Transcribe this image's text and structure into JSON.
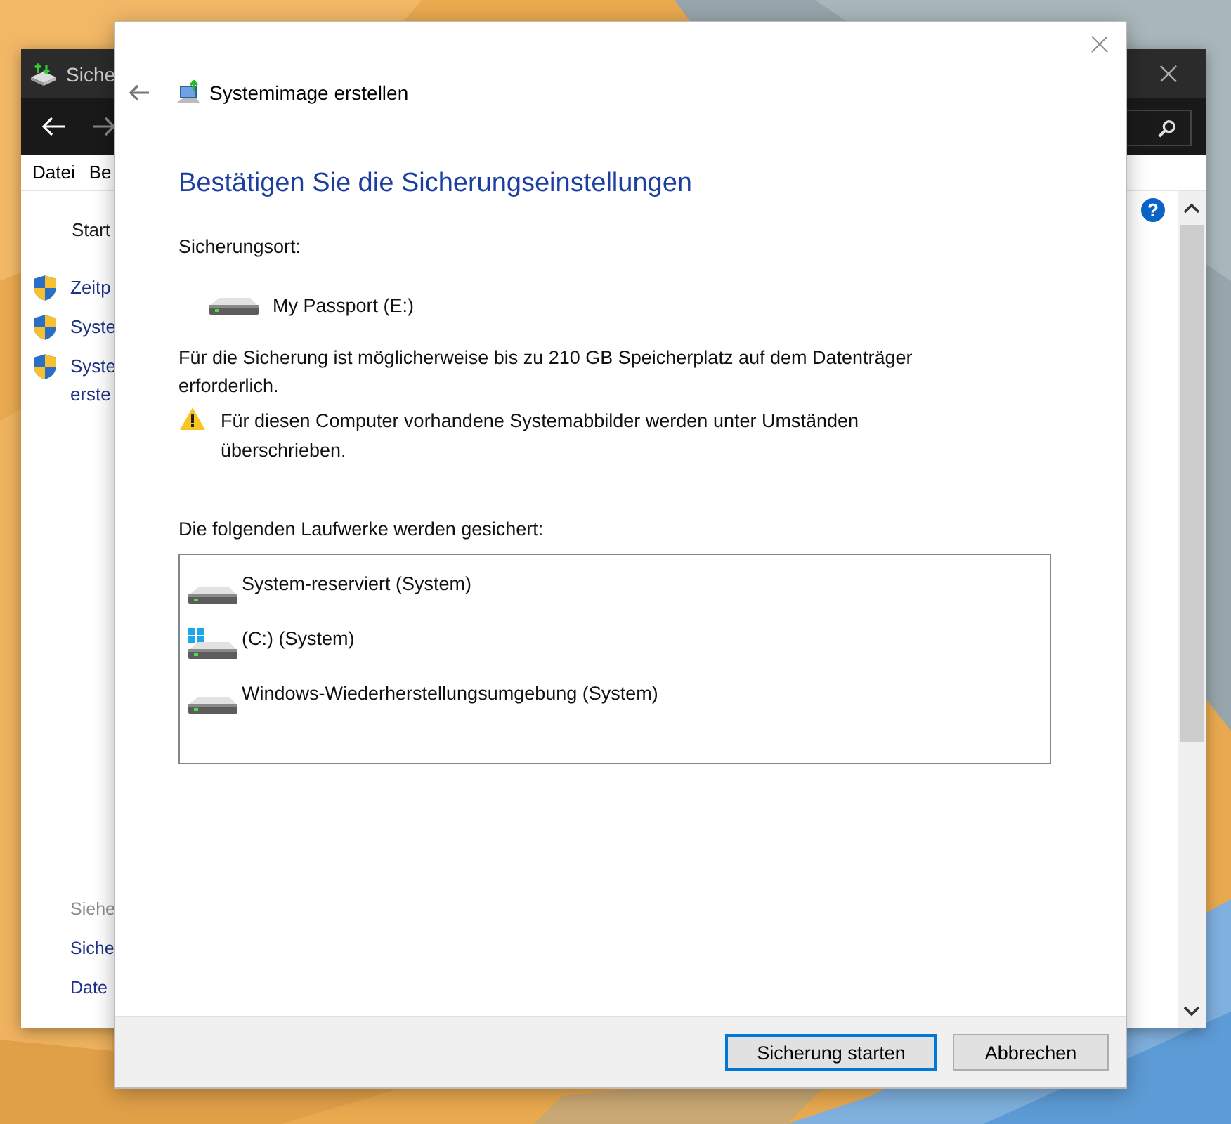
{
  "back_window": {
    "title": "Siche",
    "menu": [
      "Datei",
      "Be"
    ],
    "nav_items": [
      {
        "label": "Start"
      }
    ],
    "tasks": [
      {
        "lines": [
          "Zeitp"
        ]
      },
      {
        "lines": [
          "Syste"
        ]
      },
      {
        "lines": [
          "Syste",
          "erste"
        ]
      }
    ],
    "help": "?",
    "see_also": {
      "heading": "Siehe",
      "links": [
        "Siche",
        "Date"
      ]
    }
  },
  "dialog": {
    "title": "Systemimage erstellen",
    "heading": "Bestätigen Sie die Sicherungseinstellungen",
    "location_label": "Sicherungsort:",
    "location": "My Passport (E:)",
    "space_note": "Für die Sicherung ist möglicherweise bis zu 210 GB Speicherplatz auf dem Datenträger erforderlich.",
    "warning": "Für diesen Computer vorhandene Systemabbilder werden unter Umständen überschrieben.",
    "drives_label": "Die folgenden Laufwerke werden gesichert:",
    "drives": [
      {
        "name": "System-reserviert (System)",
        "kind": "disk"
      },
      {
        "name": "(C:) (System)",
        "kind": "system"
      },
      {
        "name": "Windows-Wiederherstellungsumgebung (System)",
        "kind": "disk"
      }
    ],
    "buttons": [
      {
        "label": "Sicherung starten",
        "default": true
      },
      {
        "label": "Abbrechen",
        "default": false
      }
    ]
  }
}
